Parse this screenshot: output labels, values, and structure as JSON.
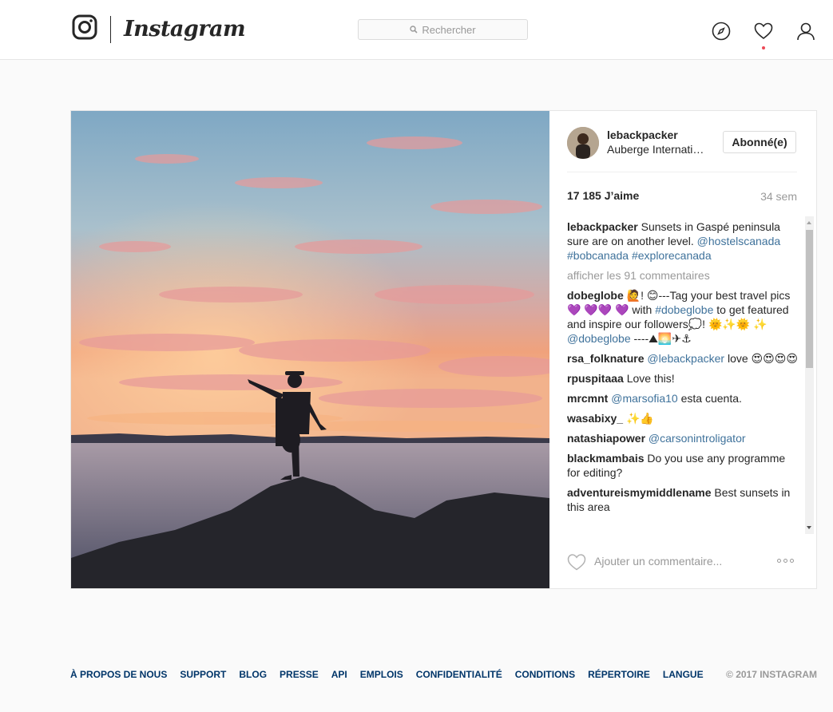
{
  "header": {
    "wordmark": "Instagram",
    "search_placeholder": "Rechercher",
    "icons": [
      "instagram-logo-icon",
      "search-icon",
      "compass-icon",
      "heart-icon",
      "profile-icon"
    ],
    "notification_color": "#ed4956"
  },
  "post": {
    "username": "lebackpacker",
    "location": "Auberge Internationale",
    "follow_label": "Abonné(e)",
    "likes": "17 185 J’aime",
    "age": "34 sem",
    "caption": {
      "user": "lebackpacker",
      "text": " Sunsets in Gaspé peninsula sure are on another level. ",
      "tags": "@hostelscanada #bobcanada #explorecanada"
    },
    "view_all": "afficher les 91 commentaires",
    "comments": [
      {
        "user": "dobeglobe",
        "text": " 🙋! 😊---Tag your best travel pics💜 💜💜 💜 with ",
        "mention": "#dobeglobe",
        "text2": " to get featured and inspire our followers💭! 🌞✨🌞 ✨ ",
        "mention2": "@dobeglobe",
        "text3": " ----⛰🌅✈⚓"
      },
      {
        "user": "rsa_folknature",
        "text": " ",
        "mention": "@lebackpacker",
        "text2": " love 😍😍😍😍",
        "mention2": "",
        "text3": ""
      },
      {
        "user": "rpuspitaaa",
        "text": " Love this!",
        "mention": "",
        "text2": "",
        "mention2": "",
        "text3": ""
      },
      {
        "user": "mrcmnt",
        "text": " ",
        "mention": "@marsofia10",
        "text2": " esta cuenta.",
        "mention2": "",
        "text3": ""
      },
      {
        "user": "wasabixy_",
        "text": " ✨👍",
        "mention": "",
        "text2": "",
        "mention2": "",
        "text3": ""
      },
      {
        "user": "natashiapower",
        "text": " ",
        "mention": "@carsonintroligator",
        "text2": "",
        "mention2": "",
        "text3": ""
      },
      {
        "user": "blackmambais",
        "text": " Do you use any programme for editing?",
        "mention": "",
        "text2": "",
        "mention2": "",
        "text3": ""
      },
      {
        "user": "adventureismymiddlename",
        "text": " Best sunsets in this area",
        "mention": "",
        "text2": "",
        "mention2": "",
        "text3": ""
      }
    ],
    "add_comment_placeholder": "Ajouter un commentaire...",
    "mention_color": "#3f729b"
  },
  "footer": {
    "links": [
      "À PROPOS DE NOUS",
      "SUPPORT",
      "BLOG",
      "PRESSE",
      "API",
      "EMPLOIS",
      "CONFIDENTIALITÉ",
      "CONDITIONS",
      "RÉPERTOIRE",
      "LANGUE"
    ],
    "copyright": "© 2017 INSTAGRAM"
  }
}
